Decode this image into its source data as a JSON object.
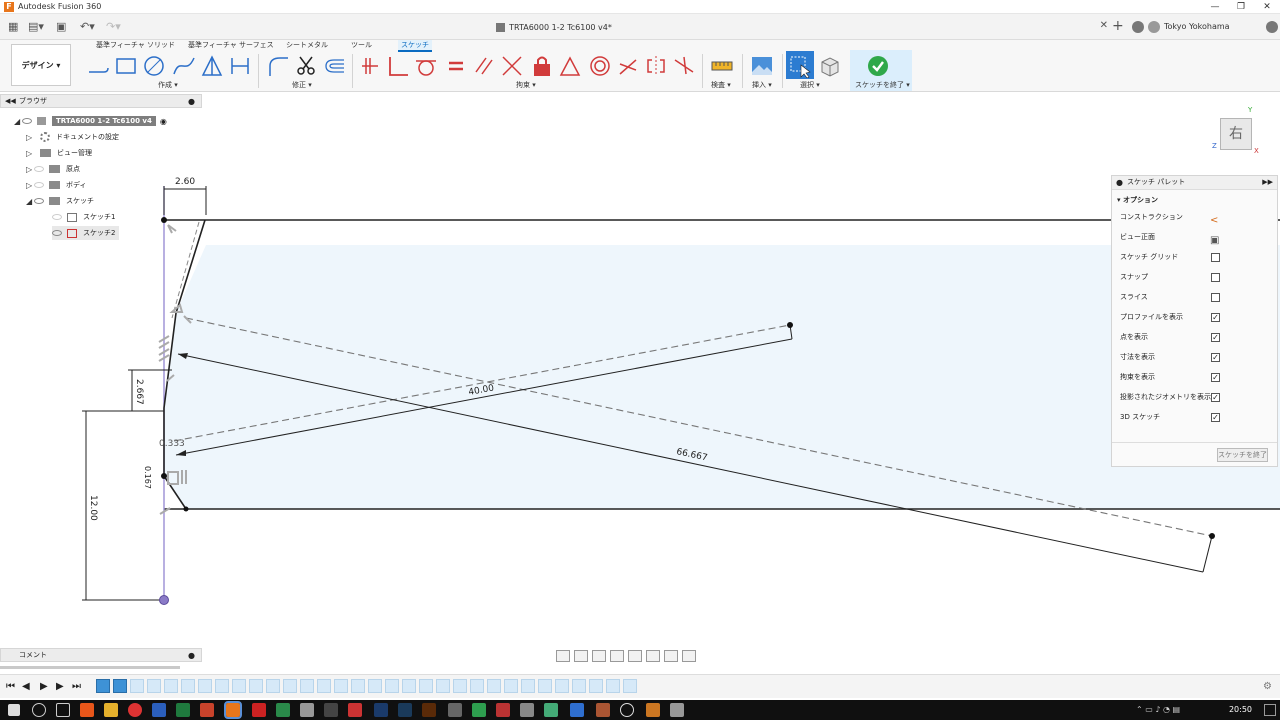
{
  "window": {
    "title": "Autodesk Fusion 360",
    "logo_letter": "F"
  },
  "document": {
    "tab_title": "TRTA6000 1-2 Tc6100 v4*",
    "user": "Tokyo Yokohama"
  },
  "ribbon": {
    "workspace": "デザイン",
    "tabs": [
      "基準フィーチャ ソリッド",
      "基準フィーチャ サーフェス",
      "シートメタル",
      "ツール",
      "スケッチ"
    ],
    "active_tab": "スケッチ",
    "groups": {
      "create": "作成 ▾",
      "modify": "修正 ▾",
      "constraints": "拘束 ▾",
      "inspect": "検査 ▾",
      "insert": "挿入 ▾",
      "select": "選択 ▾",
      "finish": "スケッチを終了 ▾"
    }
  },
  "browser": {
    "header": "ブラウザ",
    "root": "TRTA6000 1-2 Tc6100 v4",
    "items": [
      "ドキュメントの設定",
      "ビュー管理",
      "原点",
      "ボディ",
      "スケッチ"
    ],
    "sketches": [
      "スケッチ1",
      "スケッチ2"
    ]
  },
  "palette": {
    "header": "スケッチ パレット",
    "section": "オプション",
    "options": [
      {
        "label": "コンストラクション",
        "kind": "icon",
        "icon": "construction-icon"
      },
      {
        "label": "ビュー正面",
        "kind": "icon",
        "icon": "look-at-icon"
      },
      {
        "label": "スケッチ グリッド",
        "kind": "check",
        "checked": false
      },
      {
        "label": "スナップ",
        "kind": "check",
        "checked": false
      },
      {
        "label": "スライス",
        "kind": "check",
        "checked": false
      },
      {
        "label": "プロファイルを表示",
        "kind": "check",
        "checked": true
      },
      {
        "label": "点を表示",
        "kind": "check",
        "checked": true
      },
      {
        "label": "寸法を表示",
        "kind": "check",
        "checked": true
      },
      {
        "label": "拘束を表示",
        "kind": "check",
        "checked": true
      },
      {
        "label": "投影されたジオメトリを表示",
        "kind": "check",
        "checked": true
      },
      {
        "label": "3D スケッチ",
        "kind": "check",
        "checked": true
      }
    ],
    "finish_button": "スケッチを終了"
  },
  "viewcube": {
    "face": "右",
    "axis_x": "X",
    "axis_y": "Y",
    "axis_z": "Z"
  },
  "dimensions": {
    "top_width": "2.60",
    "left_short": "2.667",
    "angled_40": "40.00",
    "angled_long": "66.667",
    "small_a": "0.333",
    "small_b": "0.167",
    "height": "12.00"
  },
  "comments": {
    "label": "コメント"
  },
  "taskbar": {
    "time": "20:50"
  },
  "colors": {
    "accent": "#0a6bc1",
    "profile_fill": "#eef6fc",
    "finish_green": "#2fa84a"
  }
}
